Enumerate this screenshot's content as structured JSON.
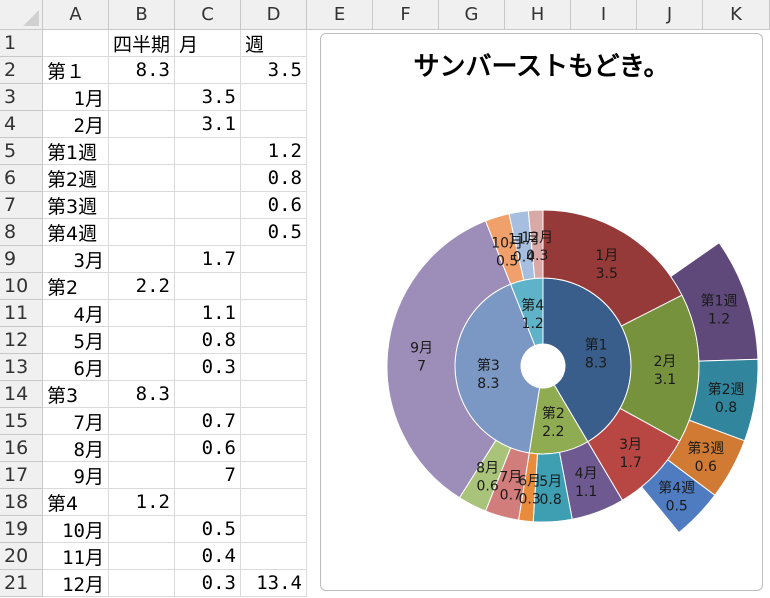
{
  "columns": [
    "A",
    "B",
    "C",
    "D",
    "E",
    "F",
    "G",
    "H",
    "I",
    "J",
    "K"
  ],
  "rows": [
    [
      "",
      "四半期",
      "月",
      "週"
    ],
    [
      "第１",
      "8.3",
      "",
      "3.5"
    ],
    [
      "1月",
      "",
      "3.5",
      ""
    ],
    [
      "2月",
      "",
      "3.1",
      ""
    ],
    [
      "第1週",
      "",
      "",
      "1.2"
    ],
    [
      "第2週",
      "",
      "",
      "0.8"
    ],
    [
      "第3週",
      "",
      "",
      "0.6"
    ],
    [
      "第4週",
      "",
      "",
      "0.5"
    ],
    [
      "3月",
      "",
      "1.7",
      ""
    ],
    [
      "第2",
      "2.2",
      "",
      ""
    ],
    [
      "4月",
      "",
      "1.1",
      ""
    ],
    [
      "5月",
      "",
      "0.8",
      ""
    ],
    [
      "6月",
      "",
      "0.3",
      ""
    ],
    [
      "第3",
      "8.3",
      "",
      ""
    ],
    [
      "7月",
      "",
      "0.7",
      ""
    ],
    [
      "8月",
      "",
      "0.6",
      ""
    ],
    [
      "9月",
      "",
      "7",
      ""
    ],
    [
      "第4",
      "1.2",
      "",
      ""
    ],
    [
      "10月",
      "",
      "0.5",
      ""
    ],
    [
      "11月",
      "",
      "0.4",
      ""
    ],
    [
      "12月",
      "",
      "0.3",
      "13.4"
    ]
  ],
  "chart_data": {
    "type": "sunburst",
    "title": "サンバーストもどき。",
    "rings": [
      {
        "name": "四半期",
        "segments": [
          {
            "label": "第1",
            "value": 8.3,
            "color": "#3a5e8c"
          },
          {
            "label": "第2",
            "value": 2.2,
            "color": "#8fac52"
          },
          {
            "label": "第3",
            "value": 8.3,
            "color": "#7b97c4"
          },
          {
            "label": "第4",
            "value": 1.2,
            "color": "#5fb3c9"
          }
        ]
      },
      {
        "name": "月",
        "segments": [
          {
            "label": "1月",
            "value": 3.5,
            "color": "#953a38"
          },
          {
            "label": "2月",
            "value": 3.1,
            "color": "#76923c"
          },
          {
            "label": "3月",
            "value": 1.7,
            "color": "#b84744"
          },
          {
            "label": "4月",
            "value": 1.1,
            "color": "#6e5a91"
          },
          {
            "label": "5月",
            "value": 0.8,
            "color": "#3e9fb3"
          },
          {
            "label": "6月",
            "value": 0.3,
            "color": "#e88c3c"
          },
          {
            "label": "7月",
            "value": 0.7,
            "color": "#d17d7b"
          },
          {
            "label": "8月",
            "value": 0.6,
            "color": "#a9c47a"
          },
          {
            "label": "9月",
            "value": 7,
            "color": "#9d8db9"
          },
          {
            "label": "10月",
            "value": 0.5,
            "color": "#f0a06a"
          },
          {
            "label": "11月",
            "value": 0.4,
            "color": "#a6bee0"
          },
          {
            "label": "12月",
            "value": 0.3,
            "color": "#d9a9a8"
          }
        ]
      },
      {
        "name": "週",
        "segments": [
          {
            "label": "第1週",
            "value": 1.2,
            "color": "#5f497a"
          },
          {
            "label": "第2週",
            "value": 0.8,
            "color": "#31859c"
          },
          {
            "label": "第3週",
            "value": 0.6,
            "color": "#d07a34"
          },
          {
            "label": "第4週",
            "value": 0.5,
            "color": "#4f7cc0"
          }
        ]
      }
    ]
  }
}
